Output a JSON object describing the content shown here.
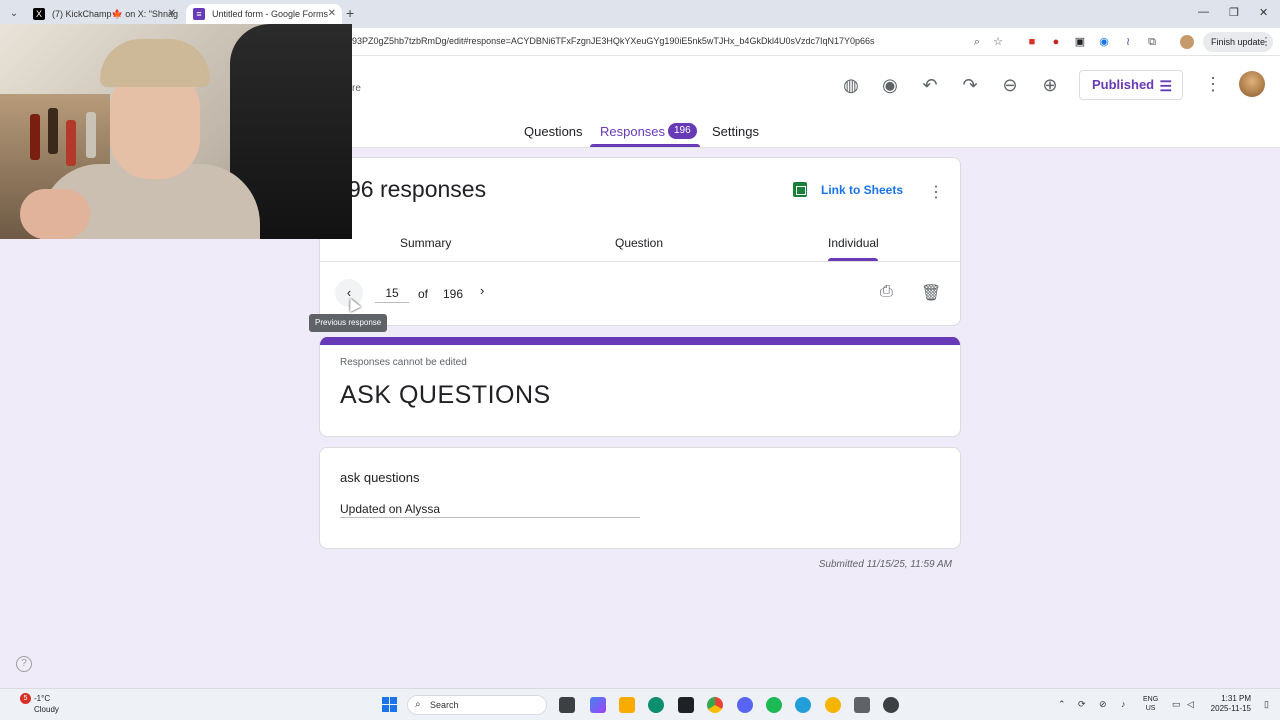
{
  "browser": {
    "tabs": [
      {
        "title": "(7) KickChamp🍁 on X: \"Shnag"
      },
      {
        "title": "Untitled form - Google Forms"
      }
    ],
    "url": "93PZ0gZ5hb7tzbRmDg/edit#response=ACYDBNi6TFxFzgnJE3HQkYXeuGYg190iE5nk5wTJHx_b4GkDkl4U0sVzdc7IqN17Y0p66s",
    "finish_update": "Finish update"
  },
  "form_header": {
    "truncated_label": "re",
    "publish_button": "Published",
    "tabs": {
      "questions": "Questions",
      "responses": "Responses",
      "responses_count": "196",
      "settings": "Settings"
    }
  },
  "responses": {
    "title": "96 responses",
    "link_sheets": "Link to Sheets",
    "view_tabs": {
      "summary": "Summary",
      "question": "Question",
      "individual": "Individual"
    },
    "pager": {
      "current": "15",
      "of": "of",
      "total": "196"
    },
    "tooltip": "Previous response"
  },
  "form": {
    "cannot_edit": "Responses cannot be edited",
    "title": "ASK QUESTIONS",
    "question": "ask questions",
    "answer": "Updated on Alyssa",
    "submitted": "Submitted 11/15/25, 11:59 AM"
  },
  "taskbar": {
    "weather_badge": "5",
    "temp": "-1°C",
    "weather": "Cloudy",
    "search": "Search",
    "lang_top": "ENG",
    "lang_bottom": "US",
    "time": "1:31 PM",
    "date": "2025-11-15"
  },
  "colors": {
    "accent": "#673ab7",
    "background": "#f0ebf8",
    "link": "#1a73e8",
    "sheets_green": "#188038"
  }
}
